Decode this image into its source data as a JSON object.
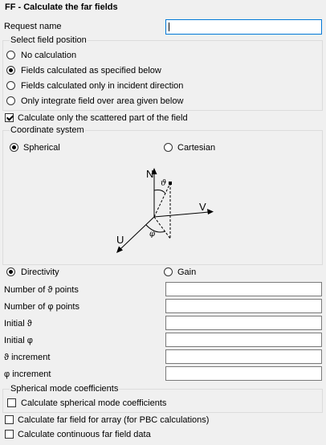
{
  "header": {
    "title": "FF - Calculate the far fields"
  },
  "request": {
    "label": "Request name",
    "value": ""
  },
  "field_position": {
    "legend": "Select field position",
    "options": [
      {
        "label": "No calculation",
        "selected": false
      },
      {
        "label": "Fields calculated as specified below",
        "selected": true
      },
      {
        "label": "Fields calculated only in incident direction",
        "selected": false
      },
      {
        "label": "Only integrate field over area given below",
        "selected": false
      }
    ]
  },
  "scattered_only": {
    "label": "Calculate only the scattered part of the field",
    "checked": true
  },
  "coordinate_system": {
    "legend": "Coordinate system",
    "spherical": "Spherical",
    "cartesian": "Cartesian",
    "selected": "Spherical",
    "diagram": {
      "n": "N",
      "v": "V",
      "u": "U",
      "theta": "ϑ",
      "phi": "φ"
    }
  },
  "output_type": {
    "directivity": "Directivity",
    "gain": "Gain",
    "selected": "Directivity"
  },
  "fields": [
    {
      "label": "Number of ϑ points",
      "value": ""
    },
    {
      "label": "Number of φ points",
      "value": ""
    },
    {
      "label": "Initial ϑ",
      "value": ""
    },
    {
      "label": "Initial φ",
      "value": ""
    },
    {
      "label": "ϑ increment",
      "value": ""
    },
    {
      "label": "φ increment",
      "value": ""
    }
  ],
  "spherical_modes": {
    "legend": "Spherical mode coefficients",
    "label": "Calculate spherical mode coefficients",
    "checked": false
  },
  "array_pbc": {
    "label": "Calculate far field for array (for PBC calculations)",
    "checked": false
  },
  "continuous": {
    "label": "Calculate continuous far field data",
    "checked": false
  },
  "colors": {
    "focus_border": "#0078d7",
    "background": "#f0f0f0"
  }
}
